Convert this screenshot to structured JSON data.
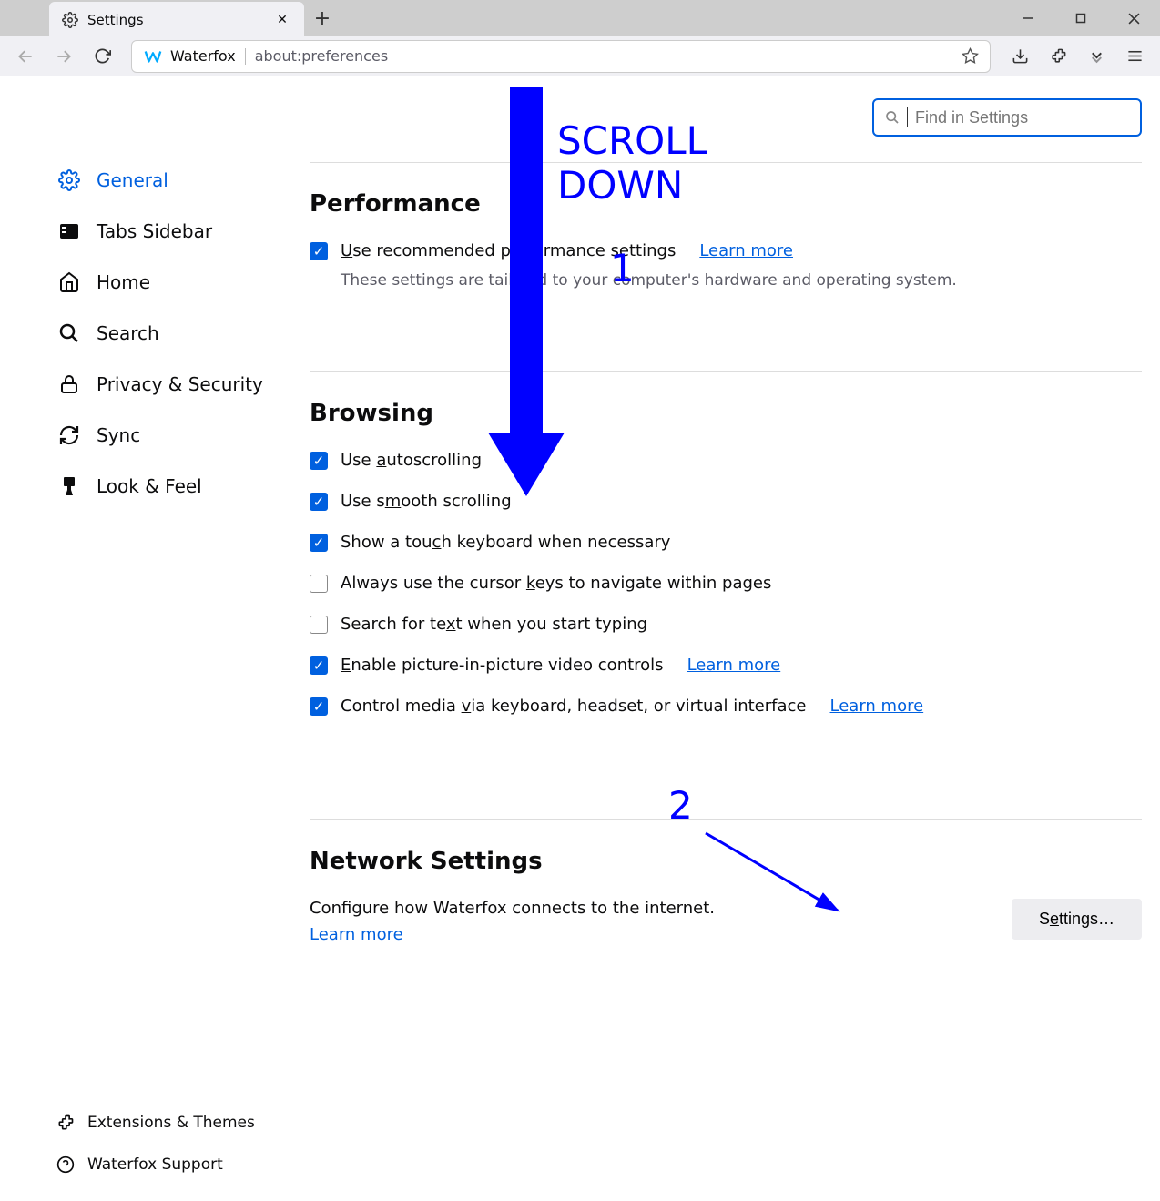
{
  "titlebar": {
    "tab_title": "Settings"
  },
  "toolbar": {
    "brand": "Waterfox",
    "url": "about:preferences"
  },
  "search": {
    "placeholder": "Find in Settings"
  },
  "sidebar": {
    "items": [
      {
        "label": "General"
      },
      {
        "label": "Tabs Sidebar"
      },
      {
        "label": "Home"
      },
      {
        "label": "Search"
      },
      {
        "label": "Privacy & Security"
      },
      {
        "label": "Sync"
      },
      {
        "label": "Look & Feel"
      }
    ],
    "footer": [
      {
        "label": "Extensions & Themes"
      },
      {
        "label": "Waterfox Support"
      }
    ]
  },
  "sections": {
    "performance": {
      "title": "Performance",
      "use_recommended": "Use recommended performance settings",
      "learn_more": "Learn more",
      "subtext": "These settings are tailored to your computer's hardware and operating system."
    },
    "browsing": {
      "title": "Browsing",
      "items": [
        {
          "label": "Use autoscrolling",
          "checked": true
        },
        {
          "label": "Use smooth scrolling",
          "checked": true
        },
        {
          "label": "Show a touch keyboard when necessary",
          "checked": true
        },
        {
          "label": "Always use the cursor keys to navigate within pages",
          "checked": false
        },
        {
          "label": "Search for text when you start typing",
          "checked": false
        },
        {
          "label": "Enable picture-in-picture video controls",
          "checked": true,
          "learn_more": "Learn more"
        },
        {
          "label": "Control media via keyboard, headset, or virtual interface",
          "checked": true,
          "learn_more": "Learn more"
        }
      ]
    },
    "network": {
      "title": "Network Settings",
      "desc": "Configure how Waterfox connects to the internet.",
      "learn_more": "Learn more",
      "button": "Settings…"
    }
  },
  "annotations": {
    "scroll_text": "SCROLL DOWN",
    "step1": "1",
    "step2": "2"
  }
}
